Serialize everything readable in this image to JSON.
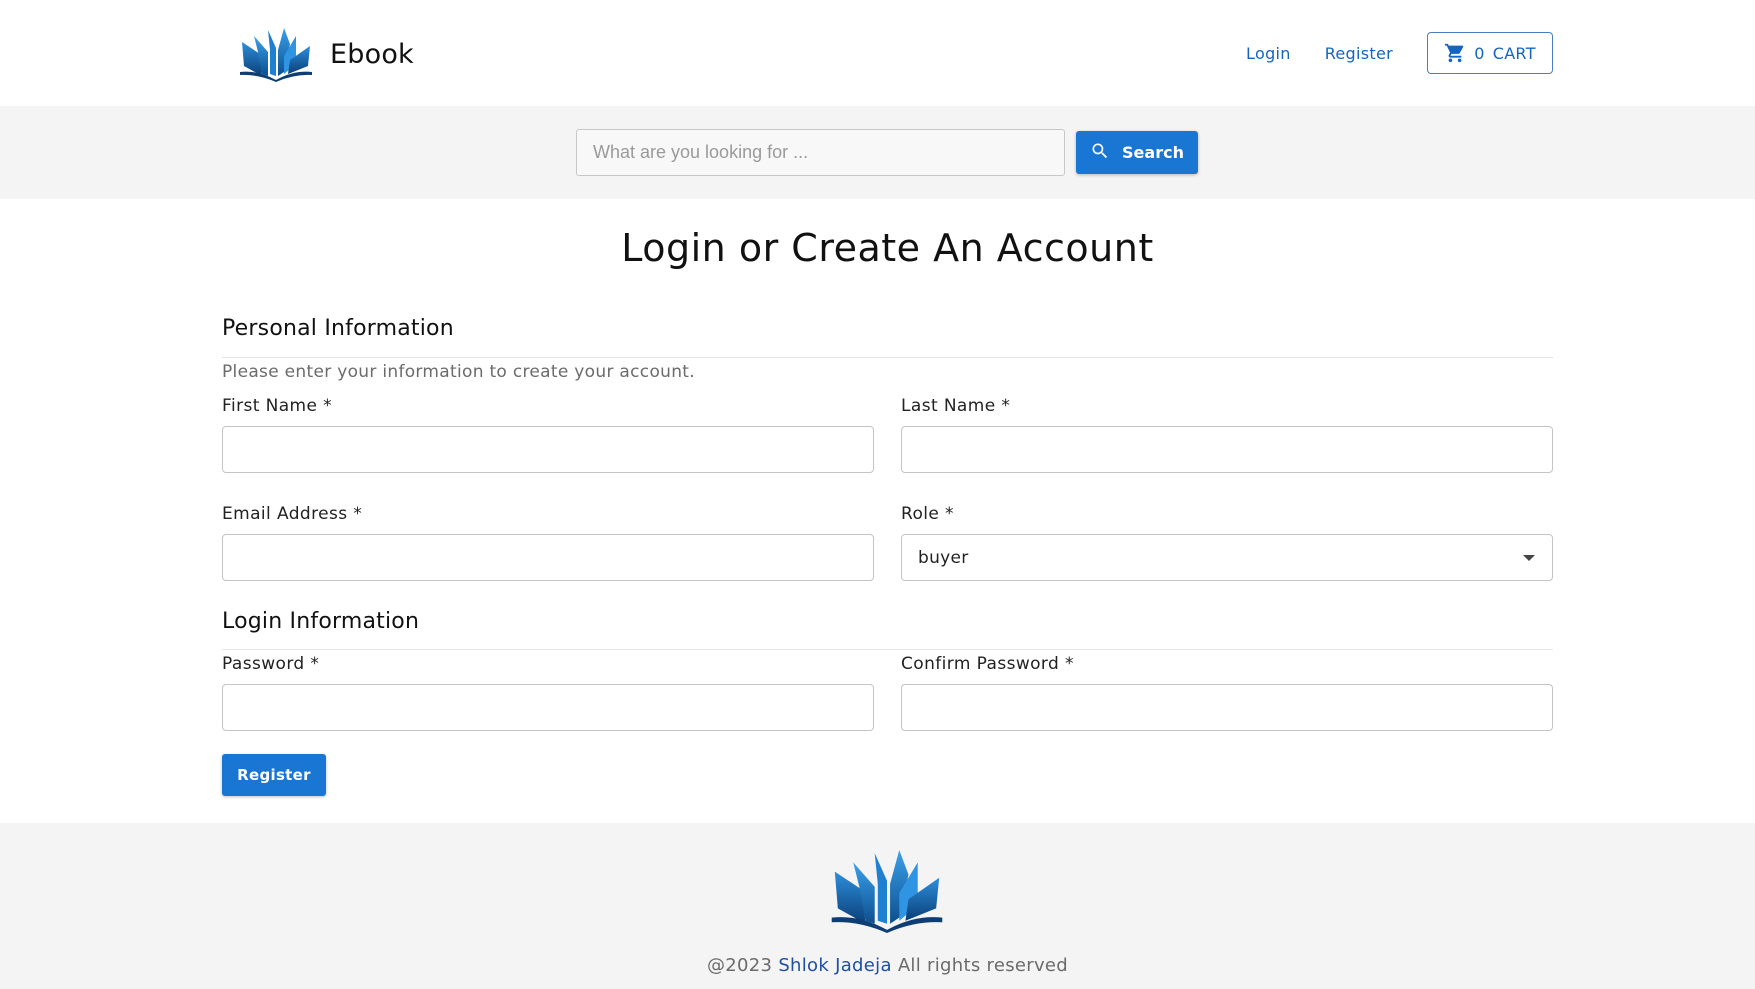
{
  "header": {
    "brand": "Ebook",
    "nav": {
      "login": "Login",
      "register": "Register"
    },
    "cart": {
      "count": "0",
      "label": "CART"
    }
  },
  "search": {
    "placeholder": "What are you looking for ...",
    "button_label": "Search"
  },
  "page": {
    "title": "Login or Create An Account"
  },
  "personal_section": {
    "title": "Personal Information",
    "helper": "Please enter your information to create your account.",
    "first_name_label": "First Name *",
    "last_name_label": "Last Name *",
    "email_label": "Email Address *",
    "role_label": "Role *",
    "role_value": "buyer"
  },
  "login_section": {
    "title": "Login Information",
    "password_label": "Password *",
    "confirm_password_label": "Confirm Password *"
  },
  "form": {
    "submit_label": "Register"
  },
  "footer": {
    "copyright": "@2023",
    "author": "Shlok Jadeja",
    "rights": "All rights reserved"
  },
  "colors": {
    "primary": "#1976d2",
    "link": "#1565c0",
    "band_bg": "#f4f4f4"
  },
  "icons": {
    "logo": "open-book-icon",
    "cart": "cart-icon",
    "search": "search-icon",
    "select": "caret-down-icon"
  }
}
